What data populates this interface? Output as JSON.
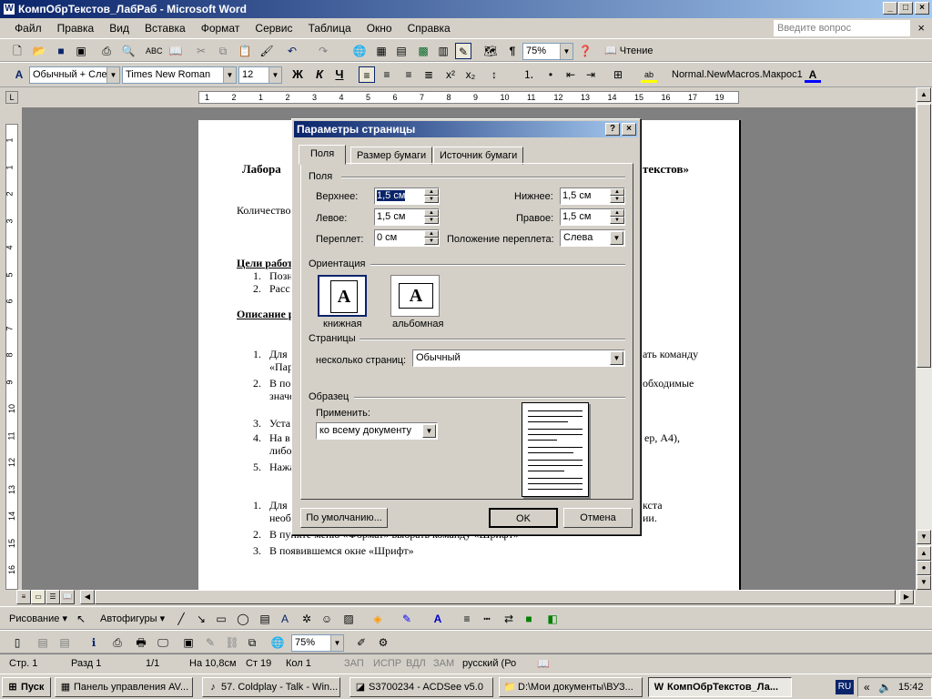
{
  "window": {
    "title": "КомпОбрТекстов_ЛабРаб - Microsoft Word",
    "app_icon": "word-icon"
  },
  "menu": {
    "items": [
      "Файл",
      "Правка",
      "Вид",
      "Вставка",
      "Формат",
      "Сервис",
      "Таблица",
      "Окно",
      "Справка"
    ],
    "ask_placeholder": "Введите вопрос",
    "close_glyph": "×"
  },
  "standard_toolbar": {
    "zoom": "75%",
    "read_label": "Чтение"
  },
  "formatting_toolbar": {
    "style": "Обычный + Сле",
    "font": "Times New Roman",
    "size": "12",
    "bold": "Ж",
    "italic": "К",
    "underline": "Ч",
    "superscript": "x²",
    "subscript": "x₂",
    "macro": "Normal.NewMacros.Макрос1",
    "font_color_glyph": "A"
  },
  "ruler": {
    "horizontal_ticks": [
      "1",
      "2",
      "1",
      "2",
      "3",
      "4",
      "5",
      "6",
      "7",
      "8",
      "9",
      "10",
      "11",
      "12",
      "13",
      "14",
      "15",
      "16",
      "17",
      "19"
    ],
    "vertical_ticks": [
      "1",
      "1",
      "2",
      "3",
      "4",
      "5",
      "6",
      "7",
      "8",
      "9",
      "10",
      "11",
      "12",
      "13",
      "14",
      "15",
      "16"
    ]
  },
  "document": {
    "title_left": "Лабора",
    "title_right": "текстов»",
    "line_count": "Количество",
    "goals_heading": "Цели работ",
    "goal_1_num": "1.",
    "goal_1": "Позн",
    "goal_2_num": "2.",
    "goal_2": "Расс",
    "desc_heading": "Описание р",
    "step_1_num": "1.",
    "step_1": "Для",
    "step_1_right": "ать команду",
    "step_1_cont": "«Пар",
    "step_2_num": "2.",
    "step_2": "В по",
    "step_2_right": "обходимые",
    "step_2_cont": "значе",
    "step_3_num": "3.",
    "step_3": "Уста",
    "step_4_num": "4.",
    "step_4": "На в",
    "step_4_right": "ер, А4),",
    "step_4_cont": "либо",
    "step_5_num": "5.",
    "step_5": "Нажа",
    "b1_num": "1.",
    "b1": "Для",
    "b1_right": "кста",
    "b1_cont": "необ",
    "b1_cont_right": "ии.",
    "b2_num": "2.",
    "b2": "В пункте меню «Формат» выбрать команду «Шрифт»",
    "b3_num": "3.",
    "b3": "В появившемся окне «Шрифт»"
  },
  "dialog": {
    "title": "Параметры страницы",
    "help_glyph": "?",
    "close_glyph": "×",
    "tabs": [
      "Поля",
      "Размер бумаги",
      "Источник бумаги"
    ],
    "margins_group": "Поля",
    "top_label": "Верхнее:",
    "top_value": "1,5 см",
    "bottom_label": "Нижнее:",
    "bottom_value": "1,5 см",
    "left_label": "Левое:",
    "left_value": "1,5 см",
    "right_label": "Правое:",
    "right_value": "1,5 см",
    "gutter_label": "Переплет:",
    "gutter_value": "0 см",
    "gutter_pos_label": "Положение переплета:",
    "gutter_pos_value": "Слева",
    "orientation_group": "Ориентация",
    "portrait_label": "книжная",
    "landscape_label": "альбомная",
    "orient_glyph": "A",
    "pages_group": "Страницы",
    "multiple_pages_label": "несколько страниц:",
    "multiple_pages_value": "Обычный",
    "preview_group": "Образец",
    "apply_label": "Применить:",
    "apply_value": "ко всему документу",
    "default_button": "По умолчанию...",
    "ok_button": "OK",
    "cancel_button": "Отмена"
  },
  "drawing_toolbar": {
    "drawing": "Рисование",
    "autoshapes": "Автофигуры"
  },
  "picture_toolbar": {
    "zoom": "75%"
  },
  "status": {
    "page": "Стр. 1",
    "section": "Разд 1",
    "pages": "1/1",
    "at": "На 10,8см",
    "line": "Ст 19",
    "col": "Кол 1",
    "rec": "ЗАП",
    "trk": "ИСПР",
    "ext": "ВДЛ",
    "ovr": "ЗАМ",
    "lang": "русский (Ро"
  },
  "taskbar": {
    "start": "Пуск",
    "tasks": [
      {
        "label": "Панель управления AV...",
        "icon": "control-panel-icon"
      },
      {
        "label": "57. Coldplay - Talk - Win...",
        "icon": "winamp-icon"
      },
      {
        "label": "S3700234 - ACDSee v5.0",
        "icon": "acdsee-icon"
      },
      {
        "label": "D:\\Мои документы\\ВУЗ...",
        "icon": "folder-icon"
      },
      {
        "label": "КомпОбрТекстов_Ла...",
        "icon": "word-icon"
      }
    ],
    "lang_indicator": "RU",
    "tray_arrow": "«",
    "clock": "15:42"
  }
}
